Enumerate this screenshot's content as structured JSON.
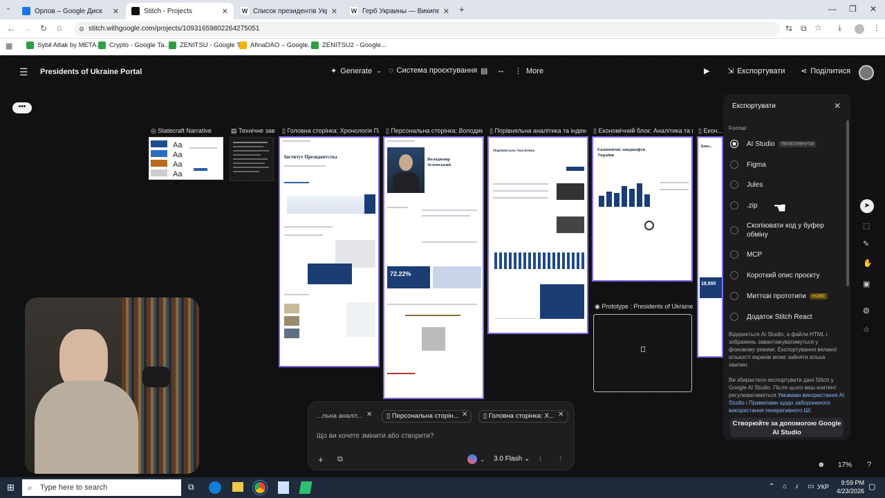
{
  "browser": {
    "tabs": [
      {
        "title": "Орлов – Google Диск",
        "color": "#1a73e8",
        "active": false
      },
      {
        "title": "Stitch - Projects",
        "color": "#111111",
        "active": true
      },
      {
        "title": "Список президентів України –",
        "color": "#555555",
        "active": false
      },
      {
        "title": "Герб Украины — Википедия",
        "color": "#555555",
        "active": false
      }
    ],
    "url": "stitch.withgoogle.com/projects/10931659802264275051",
    "bookmarks": [
      {
        "label": "Sybil Attak by META...",
        "color": "#2ea043"
      },
      {
        "label": "Crypto - Google Ta...",
        "color": "#2ea043"
      },
      {
        "label": "ZENITSU - Google T...",
        "color": "#2ea043"
      },
      {
        "label": "AfinaDAO – Google...",
        "color": "#f4b400"
      },
      {
        "label": "ZENITSU2 - Google...",
        "color": "#2ea043"
      }
    ]
  },
  "app": {
    "project_title": "Presidents of Ukraine Portal",
    "generate": "Generate",
    "design_system": "Система проєктування",
    "more": "More",
    "export": "Експортувати",
    "share": "Поділитися",
    "zoom": "17%"
  },
  "canvas": {
    "labels": [
      "Statecraft Narrative",
      "Технічне зав...",
      "Головна сторінка: Хронологія Пре...",
      "Персональна сторінка: Володим...",
      "Порівняльна аналітика та індекси ...",
      "Економічний блок: Аналітика та по...",
      "Екон..."
    ],
    "prototype_label": "Prototype : Presidents of Ukraine Hi...",
    "cards": {
      "home_title": "Інститут Президентства",
      "person_name": "Володимир Зеленський",
      "analytics_title": "Порівняльна Аналітика",
      "econ_title": "Економічні ландшафти України",
      "stat": "72.22%",
      "big_number": "18,900"
    }
  },
  "chat": {
    "chips": [
      "...льна аналіт...",
      "Персональна сторін...",
      "Головна сторінка: Х..."
    ],
    "placeholder": "Що ви хочете змінити або створити?",
    "model": "3.0 Flash"
  },
  "export_panel": {
    "title": "Експортувати",
    "format_label": "Format",
    "options": [
      {
        "label": "AI Studio",
        "tag": "ПЕРЕГЛЯНУТИ",
        "selected": true
      },
      {
        "label": "Figma",
        "tag": "",
        "selected": false
      },
      {
        "label": "Jules",
        "tag": "",
        "selected": false
      },
      {
        "label": ".zip",
        "tag": "",
        "selected": false
      },
      {
        "label": "Скопіювати код у буфер обміну",
        "tag": "",
        "selected": false
      },
      {
        "label": "MCP",
        "tag": "",
        "selected": false
      },
      {
        "label": "Короткий опис проєкту",
        "tag": "",
        "selected": false
      },
      {
        "label": "Миттєві прототипи",
        "tag": "НОВЕ",
        "selected": false
      },
      {
        "label": "Додаток Stitch React",
        "tag": "",
        "selected": false
      }
    ],
    "description": "Відкриється AI Studio, а файли HTML і зображень завантажуватимуться у фоновому режимі. Експортування великої кількості екранів може зайняти кілька хвилин.",
    "terms_prefix": "Ви збираєтеся експортувати дані Stitch у Google AI Studio. Після цього ваш контент регулюватиметься",
    "terms_link1": "Умовами використання AI Studio",
    "terms_and": "і",
    "terms_link2": "Правилами щодо забороненого використання генеративного ШІ.",
    "cta": "Створюйте за допомогою Google AI Studio"
  },
  "taskbar": {
    "search": "Type here to search",
    "lang": "УКР",
    "time": "9:59 PM",
    "date": "4/23/2026"
  },
  "colors": {
    "accent_link": "#8ab4f8",
    "canvas_bg": "#111113",
    "panel_bg": "#1c1c1f"
  }
}
